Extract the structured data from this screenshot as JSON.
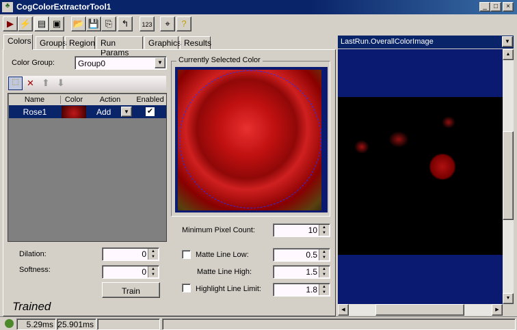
{
  "window": {
    "title": "CogColorExtractorTool1",
    "min": "_",
    "max": "□",
    "close": "×"
  },
  "toolbar": [
    {
      "icon": "run-icon",
      "glyph": "▶"
    },
    {
      "icon": "lightning-icon",
      "glyph": "⚡"
    },
    {
      "icon": "show-panel-icon",
      "glyph": "▤"
    },
    {
      "icon": "floating-panel-icon",
      "glyph": "▣"
    },
    {
      "icon": "open-icon",
      "glyph": "📂"
    },
    {
      "icon": "save-icon",
      "glyph": "💾"
    },
    {
      "icon": "save-as-icon",
      "glyph": "⎘"
    },
    {
      "icon": "reset-icon",
      "glyph": "↰"
    },
    {
      "icon": "results-icon",
      "glyph": "123"
    },
    {
      "icon": "pointer-icon",
      "glyph": "⌖"
    },
    {
      "icon": "help-icon",
      "glyph": "?"
    }
  ],
  "tabs": [
    "Colors",
    "Groups",
    "Region",
    "Run Params",
    "Graphics",
    "Results"
  ],
  "colors": {
    "group_label": "Color Group:",
    "group_value": "Group0",
    "grid": {
      "headers": [
        "Name",
        "Color",
        "Action",
        "Enabled"
      ],
      "rows": [
        {
          "name": "Rose1",
          "action": "Add",
          "enabled": true
        }
      ]
    },
    "dilation_label": "Dilation:",
    "dilation": "0",
    "softness_label": "Softness:",
    "softness": "0",
    "train": "Train",
    "status": "Trained",
    "selected_color_title": "Currently Selected Color",
    "min_pixel_label": "Minimum Pixel Count:",
    "min_pixel": "10",
    "matte_low_label": "Matte Line Low:",
    "matte_low": "0.5",
    "matte_low_checked": false,
    "matte_high_label": "Matte Line High:",
    "matte_high": "1.5",
    "highlight_label": "Highlight Line Limit:",
    "highlight": "1.8",
    "highlight_checked": false
  },
  "display": {
    "image_select": "LastRun.OverallColorImage"
  },
  "statusbar": {
    "time1": "5.29ms",
    "time2": "25.901ms",
    "indicator_color": "#4a8a2a"
  }
}
